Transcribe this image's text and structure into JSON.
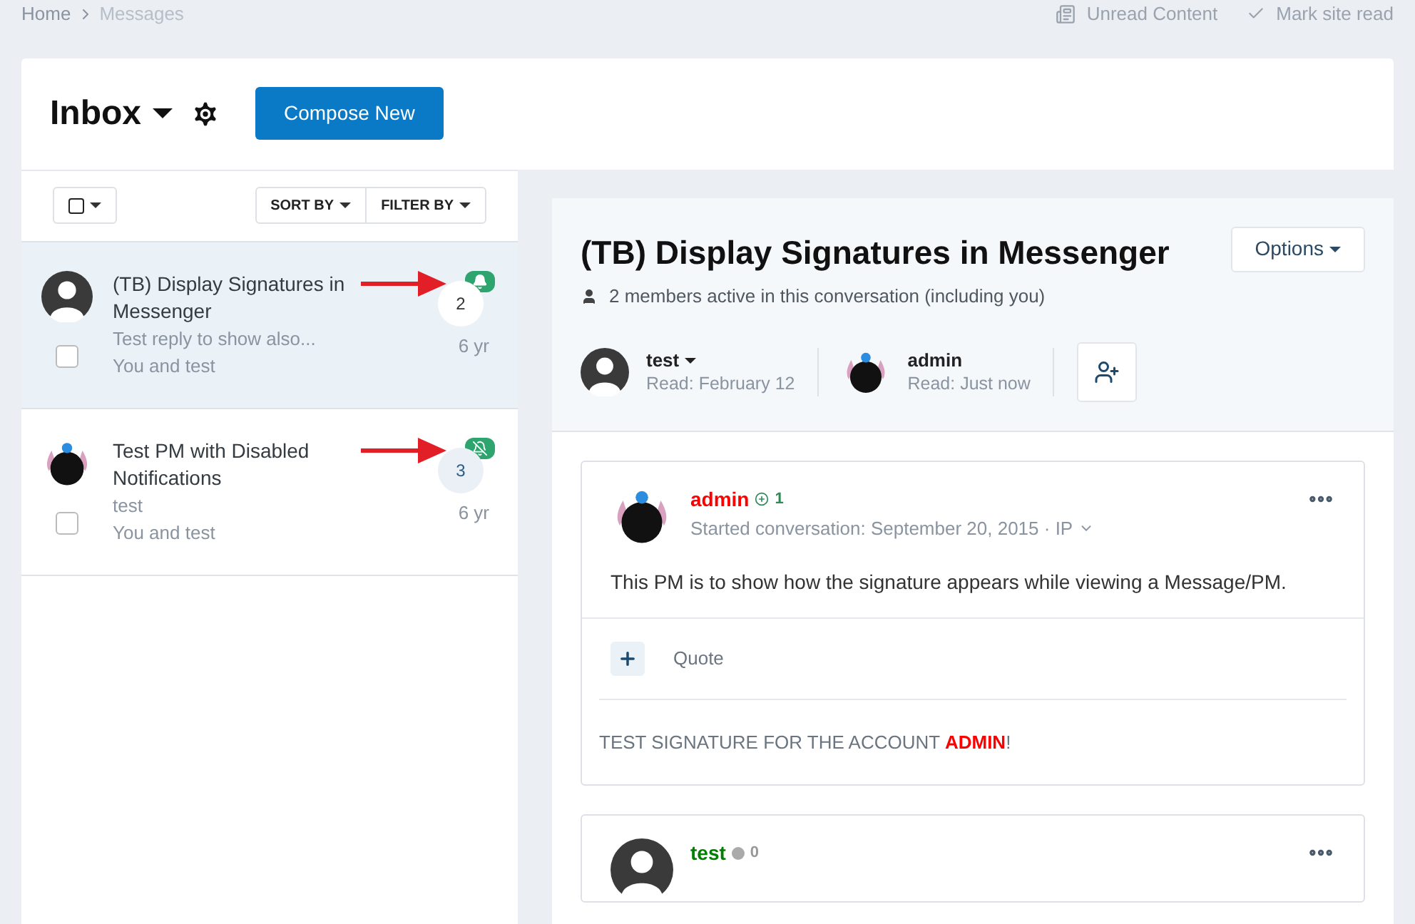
{
  "breadcrumb": [
    {
      "label": "Home",
      "current": false
    },
    {
      "label": "Messages",
      "current": true
    }
  ],
  "top_links": [
    {
      "label": "Unread Content",
      "kind": "unread"
    },
    {
      "label": "Mark site read",
      "kind": "check"
    }
  ],
  "inbox": {
    "title": "Inbox",
    "compose": "Compose New"
  },
  "list_toolbar": {
    "sort": "SORT BY",
    "filter": "FILTER BY"
  },
  "conversations": [
    {
      "title": "(TB) Display Signatures in Messenger",
      "snippet": "Test reply to show also...",
      "participants": "You and test",
      "count": "2",
      "time": "6 yr",
      "selected": true,
      "notifications": true,
      "avatar": {
        "kind": "silhouette"
      },
      "annotated": true,
      "checked": false
    },
    {
      "title": "Test PM with Disabled Notifications",
      "snippet": "test",
      "participants": "You and test",
      "count": "3",
      "time": "6 yr",
      "selected": false,
      "notifications": false,
      "avatar": {
        "kind": "bunny"
      },
      "annotated": true,
      "checked": false
    }
  ],
  "conversation": {
    "title": "(TB) Display Signatures in Messenger",
    "members_note": "2 members active in this conversation (including you)",
    "options": "Options",
    "participants": [
      {
        "name": "test",
        "read": "Read: February 12",
        "avatar": {
          "kind": "silhouette"
        },
        "has_menu": true
      },
      {
        "name": "admin",
        "read": "Read: Just now",
        "avatar": {
          "kind": "bunny"
        },
        "has_menu": false
      }
    ]
  },
  "posts": [
    {
      "author": "admin",
      "color": "#ff0000",
      "avatar": {
        "kind": "bunny"
      },
      "rep": {
        "value": "1",
        "kind": "positive"
      },
      "meta": "Started conversation: September 20, 2015 · IP",
      "body": "This PM is to show how the signature appears while viewing a Message/PM.",
      "quote": "Quote",
      "signature": {
        "text": "TEST SIGNATURE FOR THE ACCOUNT ",
        "highlight": "ADMIN",
        "suffix": "!"
      }
    },
    {
      "author": "test",
      "color": "#008000",
      "avatar": {
        "kind": "silhouette"
      },
      "rep": {
        "value": "0",
        "kind": "neutral"
      }
    }
  ]
}
